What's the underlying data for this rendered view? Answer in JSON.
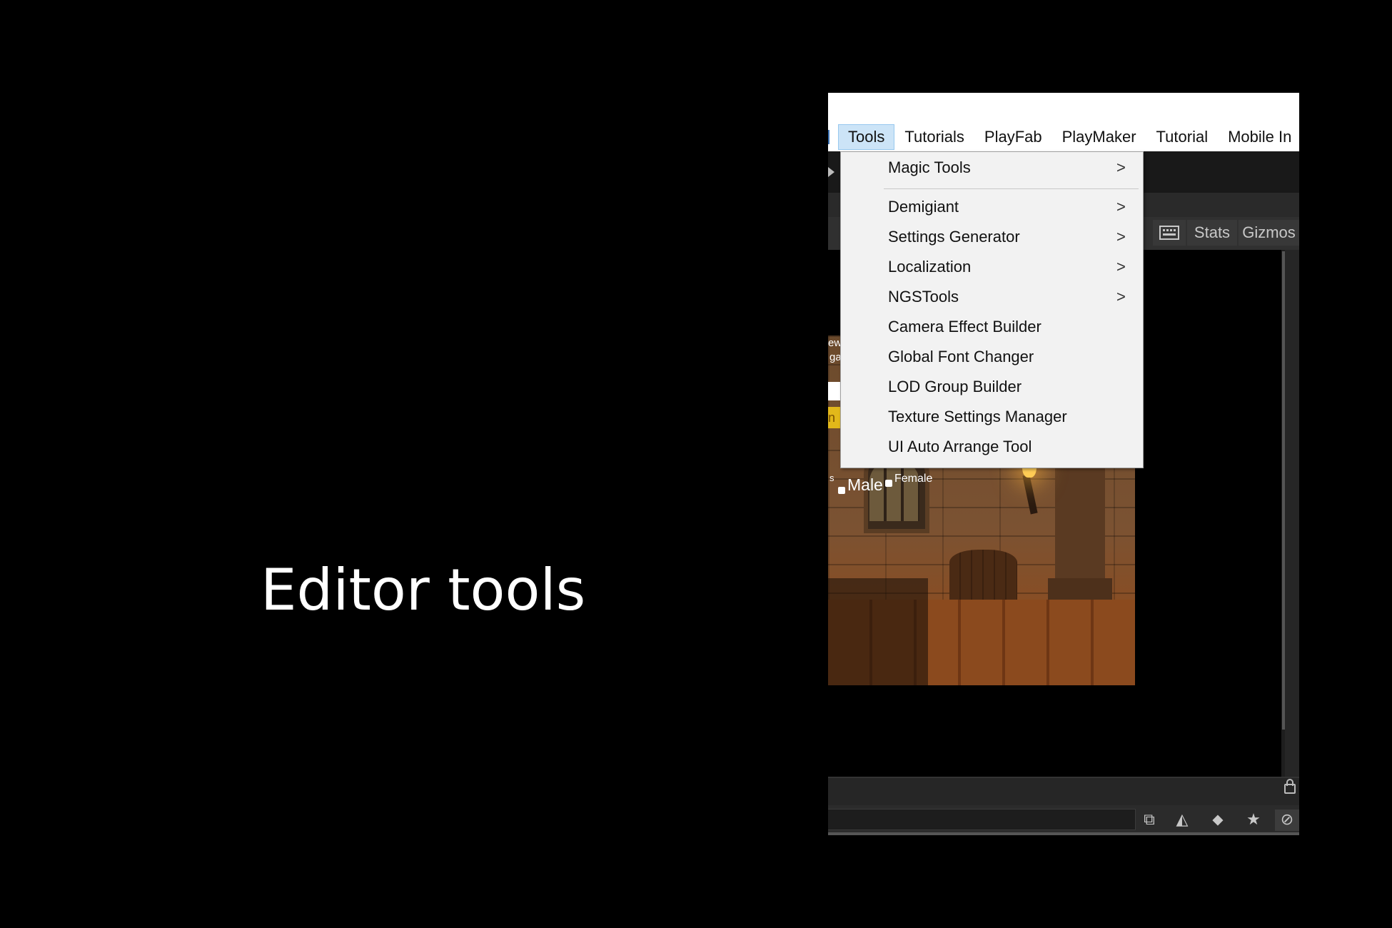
{
  "caption": "Editor tools",
  "menubar": {
    "items": [
      "Tools",
      "Tutorials",
      "PlayFab",
      "PlayMaker",
      "Tutorial",
      "Mobile In"
    ]
  },
  "scene_toolbar": {
    "stats_label": "Stats",
    "gizmos_label": "Gizmos",
    "keyboard_icon": "keyboard-icon"
  },
  "tools_menu": {
    "items": [
      {
        "label": "Magic Tools",
        "submenu": ">"
      },
      {
        "label": "Demigiant",
        "submenu": ">"
      },
      {
        "label": "Settings Generator",
        "submenu": ">"
      },
      {
        "label": "Localization",
        "submenu": ">"
      },
      {
        "label": "NGSTools",
        "submenu": ">"
      },
      {
        "label": "Camera Effect Builder"
      },
      {
        "label": "Global Font Changer"
      },
      {
        "label": "LOD Group Builder"
      },
      {
        "label": "Texture Settings Manager"
      },
      {
        "label": "UI Auto Arrange Tool"
      }
    ]
  },
  "game_view": {
    "left_frag_1": "ew",
    "left_frag_2": "ga",
    "yellow_frag": "n",
    "small_label": "s",
    "male_label": "Male",
    "female_label": "Female"
  },
  "bottom_icons": {
    "icon_1": "⧉",
    "icon_2": "◭",
    "icon_3": "⬥",
    "icon_4": "★",
    "icon_5": "⊘"
  },
  "colors": {
    "menu_active": "#cce4f7",
    "menu_bg": "#f2f2f2",
    "editor_dark": "#1e1e1e"
  }
}
